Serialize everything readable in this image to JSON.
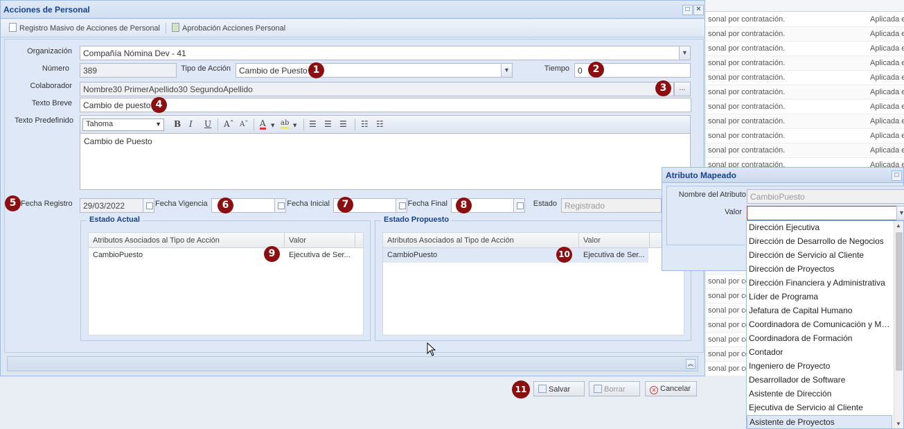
{
  "window": {
    "title": "Acciones de Personal",
    "toolbar": {
      "registro_masivo": "Registro Masivo de Acciones de Personal",
      "aprobacion": "Aprobación Acciones Personal"
    }
  },
  "form": {
    "organizacion": {
      "label": "Organización",
      "value": "Compañía Nómina Dev - 41"
    },
    "numero": {
      "label": "Número",
      "value": "389"
    },
    "tipo_accion": {
      "label": "Tipo de Acción",
      "value": "Cambio de Puesto"
    },
    "tiempo": {
      "label": "Tiempo",
      "value": "0"
    },
    "colaborador": {
      "label": "Colaborador",
      "value": "Nombre30 PrimerApellido30 SegundoApellido",
      "button": "..."
    },
    "texto_breve": {
      "label": "Texto Breve",
      "value": "Cambio de puesto"
    },
    "texto_predefinido": {
      "label": "Texto Predefinido",
      "font": "Tahoma",
      "body": "Cambio de Puesto"
    },
    "fecha_registro": {
      "label": "Fecha Registro",
      "value": "29/03/2022"
    },
    "fecha_vigencia": {
      "label": "Fecha Vigencia",
      "value": ""
    },
    "fecha_inicial": {
      "label": "Fecha Inicial",
      "value": ""
    },
    "fecha_final": {
      "label": "Fecha Final",
      "value": ""
    },
    "estado": {
      "label": "Estado",
      "placeholder": "Registrado"
    }
  },
  "editor_toolbar": {
    "bold": "B",
    "italic": "I",
    "underline": "U",
    "grow": "Aˆ",
    "shrink": "Aˇ",
    "font_color": "A",
    "highlight": "ab"
  },
  "estado_actual": {
    "legend": "Estado Actual",
    "columns": [
      "Atributos Asociados al Tipo de Acción",
      "Valor"
    ],
    "rows": [
      {
        "atributo": "CambioPuesto",
        "valor": "Ejecutiva de Ser..."
      }
    ]
  },
  "estado_propuesto": {
    "legend": "Estado Propuesto",
    "columns": [
      "Atributos Asociados al Tipo de Acción",
      "Valor"
    ],
    "rows": [
      {
        "atributo": "CambioPuesto",
        "valor": "Ejecutiva de Ser..."
      }
    ]
  },
  "actions": {
    "salvar": "Salvar",
    "borrar": "Borrar",
    "cancelar": "Cancelar"
  },
  "badges": [
    "1",
    "2",
    "3",
    "4",
    "5",
    "6",
    "7",
    "8",
    "9",
    "10",
    "11"
  ],
  "attr_dialog": {
    "title": "Atributo Mapeado",
    "nombre_label": "Nombre del Atributo",
    "nombre_placeholder": "CambioPuesto",
    "valor_label": "Valor",
    "valor_value": "",
    "options": [
      "Dirección Ejecutiva",
      "Dirección de Desarrollo de Negocios",
      "Dirección de Servicio al Cliente",
      "Dirección de Proyectos",
      "Dirección Financiera y Administrativa",
      "Líder de Programa",
      "Jefatura de Capital Humano",
      "Coordinadora de Comunicación y Me...",
      "Coordinadora de Formación",
      "Contador",
      "Ingeniero de Proyecto",
      "Desarrollador de Software",
      "Asistente de Dirección",
      "Ejecutiva de Servicio al Cliente",
      "Asistente de Proyectos"
    ],
    "selected_option": "Asistente de Proyectos"
  },
  "background_grid": {
    "col1": "sonal por contratación.",
    "col2": "Aplicada e",
    "col1_short": "sonal por co"
  },
  "colors": {
    "badge": "#8b0f10",
    "title": "#15428b",
    "panel": "#dfe8f6",
    "border": "#99bbe8"
  },
  "icons": {
    "maximize": "maximize-icon",
    "close": "close-icon",
    "calendar": "calendar-icon",
    "dropdown": "chevron-down-icon"
  }
}
